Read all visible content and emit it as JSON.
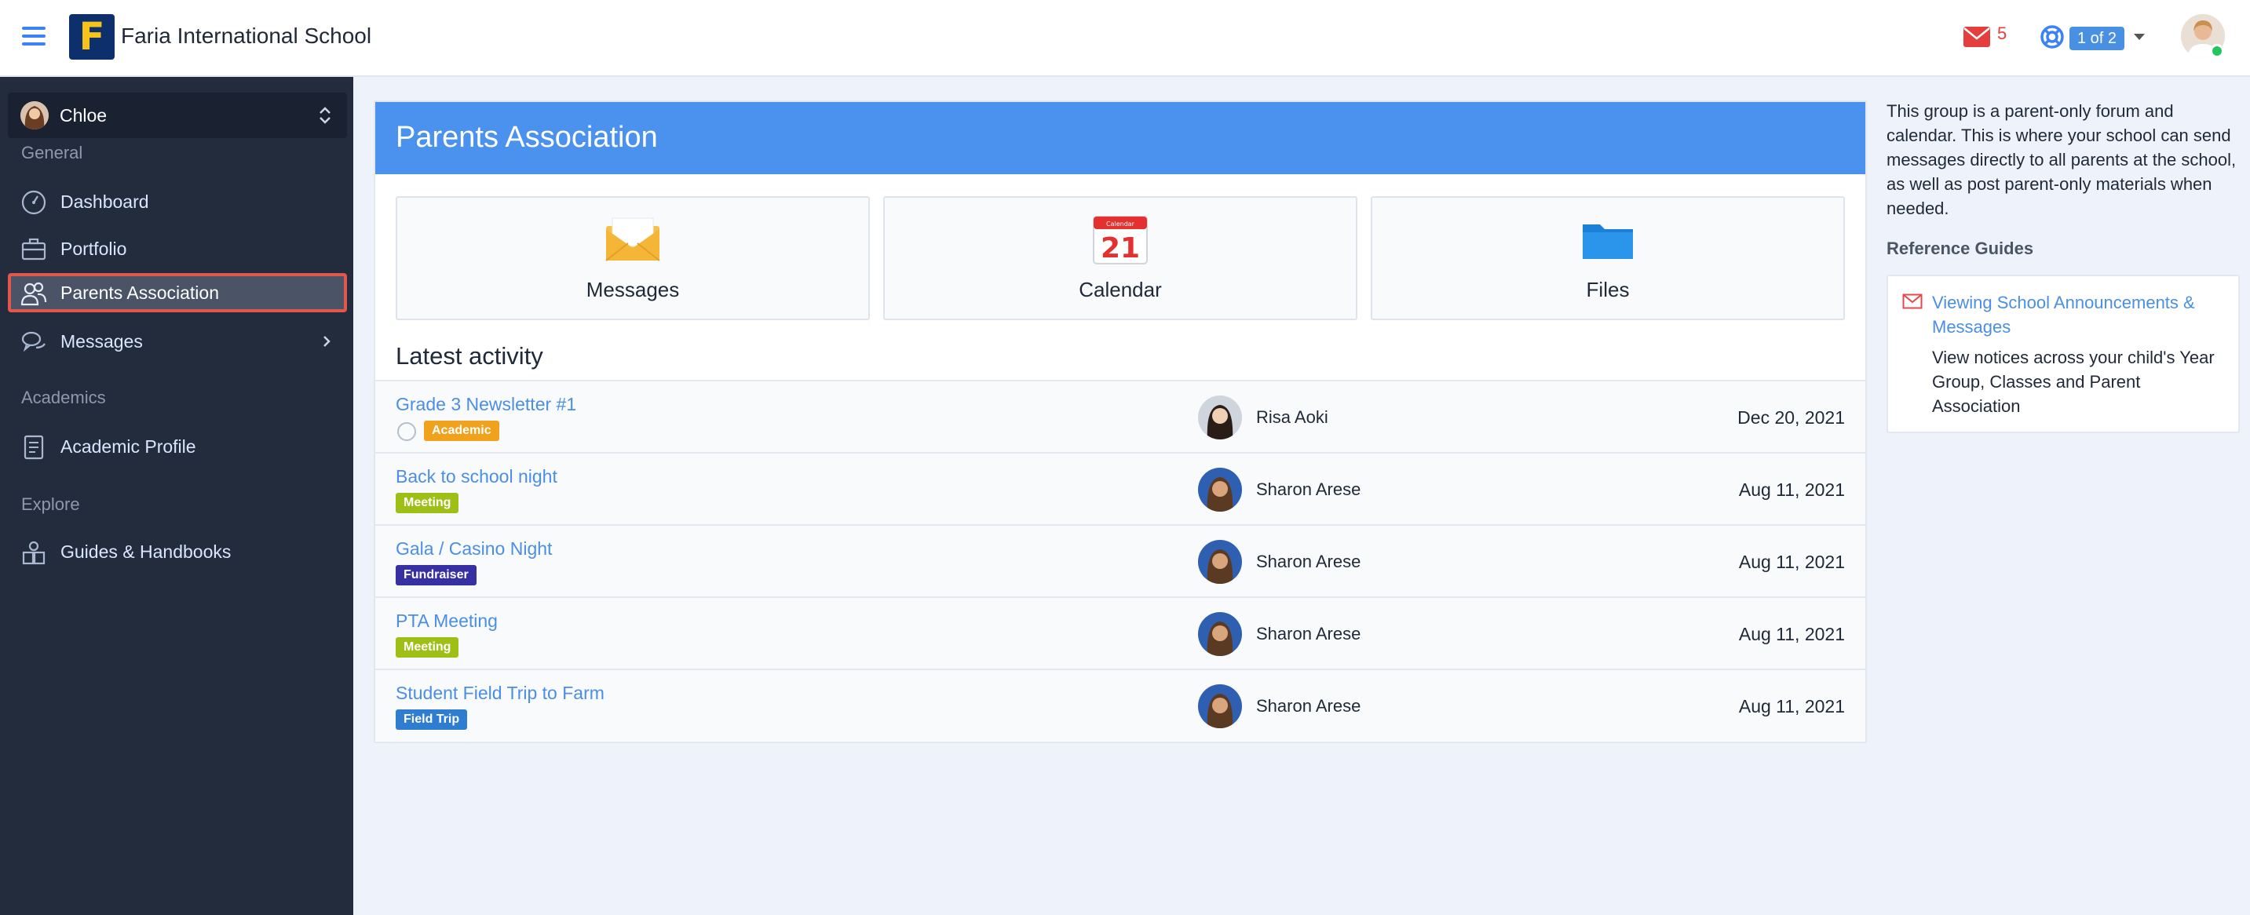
{
  "header": {
    "school_name": "Faria International School",
    "logo_letter": "F",
    "mail_count": "5",
    "page_indicator": "1 of 2"
  },
  "sidebar": {
    "user_name": "Chloe",
    "sections": {
      "general": "General",
      "academics": "Academics",
      "explore": "Explore"
    },
    "items": [
      {
        "label": "Dashboard",
        "icon": "dashboard-icon"
      },
      {
        "label": "Portfolio",
        "icon": "briefcase-icon"
      },
      {
        "label": "Parents Association",
        "icon": "parents-icon",
        "active": true
      },
      {
        "label": "Messages",
        "icon": "chat-icon"
      },
      {
        "label": "Academic Profile",
        "icon": "document-icon"
      },
      {
        "label": "Guides & Handbooks",
        "icon": "guides-icon"
      }
    ]
  },
  "main": {
    "title": "Parents Association",
    "tiles": [
      {
        "label": "Messages",
        "icon": "envelope-icon"
      },
      {
        "label": "Calendar",
        "icon": "calendar-icon",
        "day": "21",
        "month": "Calendar"
      },
      {
        "label": "Files",
        "icon": "folder-icon"
      }
    ],
    "latest_title": "Latest activity",
    "activity": [
      {
        "title": "Grade 3 Newsletter #1",
        "tag": "Academic",
        "tag_color": "#f0a21c",
        "author": "Risa Aoki",
        "date": "Dec 20, 2021"
      },
      {
        "title": "Back to school night",
        "tag": "Meeting",
        "tag_color": "#9ec016",
        "author": "Sharon Arese",
        "date": "Aug 11, 2021"
      },
      {
        "title": "Gala / Casino Night",
        "tag": "Fundraiser",
        "tag_color": "#3730a3",
        "author": "Sharon Arese",
        "date": "Aug 11, 2021"
      },
      {
        "title": "PTA Meeting",
        "tag": "Meeting",
        "tag_color": "#9ec016",
        "author": "Sharon Arese",
        "date": "Aug 11, 2021"
      },
      {
        "title": "Student Field Trip to Farm",
        "tag": "Field Trip",
        "tag_color": "#2f7dd1",
        "author": "Sharon Arese",
        "date": "Aug 11, 2021"
      }
    ]
  },
  "aside": {
    "description": "This group is a parent-only forum and calendar. This is where your school can send messages directly to all parents at the school, as well as post parent-only materials when needed.",
    "reference_title": "Reference Guides",
    "guide_link": "Viewing School Announcements & Messages",
    "guide_text": "View notices across your child's Year Group, Classes and Parent Association"
  },
  "colors": {
    "accent": "#4b91ee",
    "sidebar_bg": "#232c3d",
    "active_outline": "#e2574c",
    "link": "#4a8ee6"
  }
}
